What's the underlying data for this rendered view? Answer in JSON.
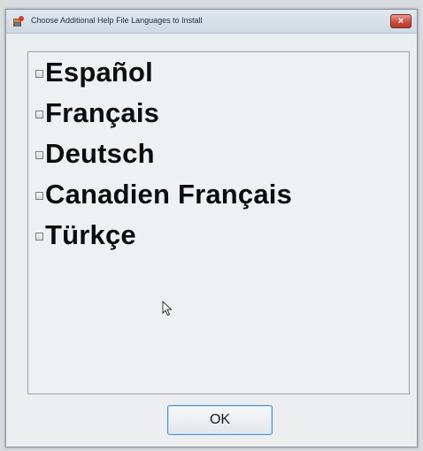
{
  "window": {
    "title": "Choose Additional Help File Languages to Install",
    "close_glyph": "×"
  },
  "languages": [
    {
      "label": "Español",
      "checked": false
    },
    {
      "label": "Français",
      "checked": false
    },
    {
      "label": "Deutsch",
      "checked": false
    },
    {
      "label": "Canadien Français",
      "checked": false
    },
    {
      "label": "Türkçe",
      "checked": false
    }
  ],
  "buttons": {
    "ok_label": "OK"
  },
  "icons": {
    "app": "installer-app-icon",
    "close": "close-icon",
    "checkbox": "checkbox-unchecked-icon",
    "cursor": "mouse-pointer-icon"
  },
  "colors": {
    "close_button": "#c9483a",
    "ok_button_border": "#4f8ec8"
  }
}
